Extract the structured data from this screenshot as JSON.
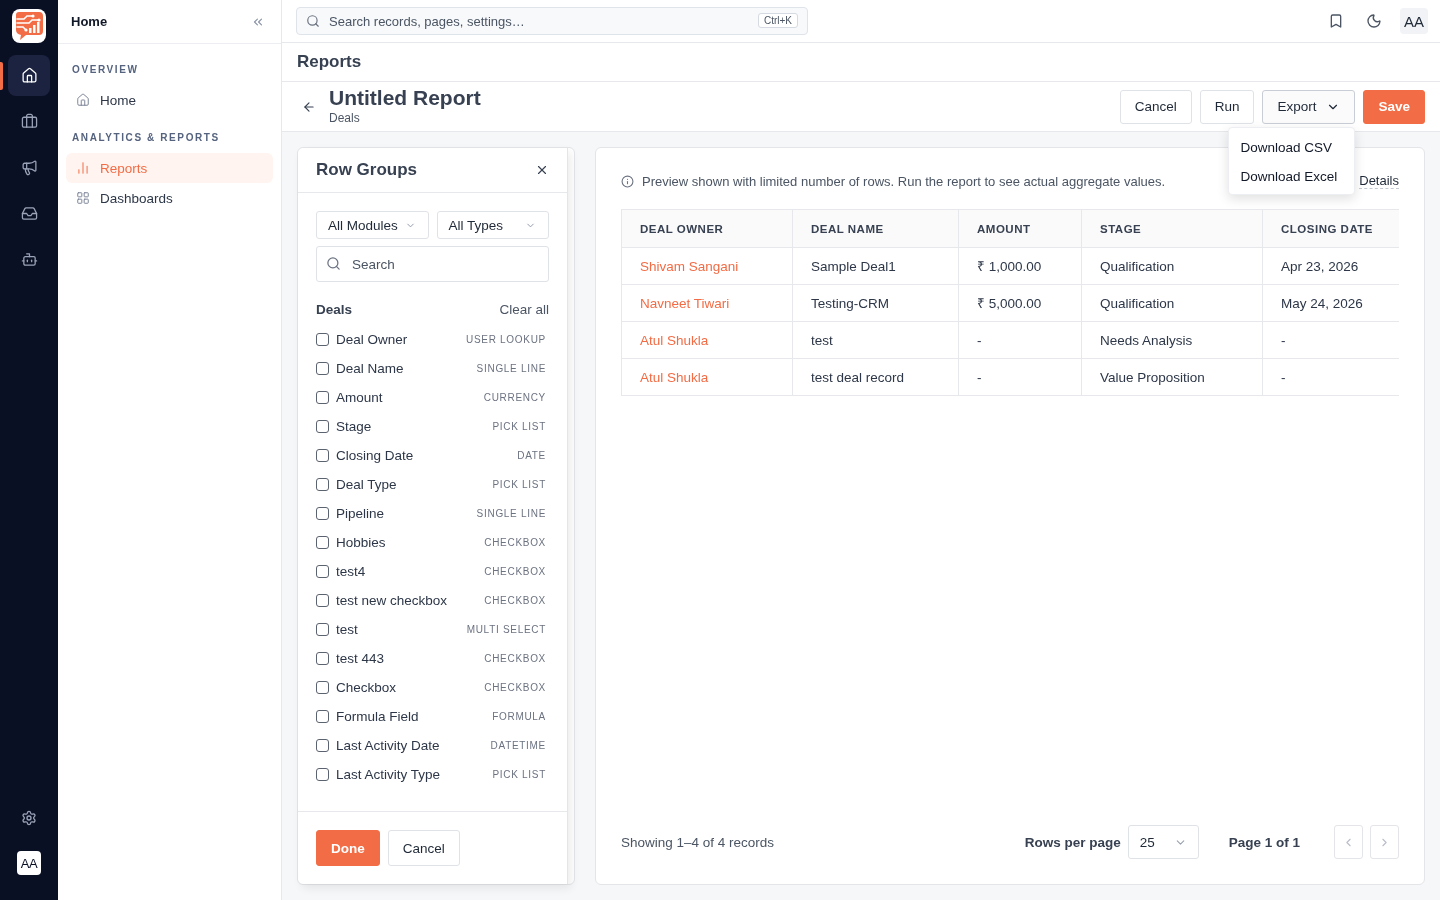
{
  "rail": {
    "nav": [
      {
        "selected": true
      },
      {
        "selected": false
      },
      {
        "selected": false
      },
      {
        "selected": false
      },
      {
        "selected": false
      }
    ],
    "avatar": "AA"
  },
  "sidebar": {
    "title": "Home",
    "sections": [
      {
        "heading": "OVERVIEW",
        "items": [
          {
            "label": "Home",
            "selected": false
          }
        ]
      },
      {
        "heading": "ANALYTICS & REPORTS",
        "items": [
          {
            "label": "Reports",
            "selected": true
          },
          {
            "label": "Dashboards",
            "selected": false
          }
        ]
      }
    ]
  },
  "topbar": {
    "search": {
      "placeholder": "Search records, pages, settings…",
      "shortcut": "Ctrl+K"
    },
    "avatar": "AA"
  },
  "page": {
    "section_title": "Reports",
    "report_title": "Untitled Report",
    "module": "Deals",
    "actions": [
      {
        "label": "Cancel",
        "kind": "secondary"
      },
      {
        "label": "Run",
        "kind": "secondary"
      },
      {
        "label": "Export",
        "kind": "menu",
        "expanded": true,
        "menu": [
          "Download CSV",
          "Download Excel"
        ]
      },
      {
        "label": "Save",
        "kind": "primary"
      }
    ]
  },
  "row_groups": {
    "title": "Row Groups",
    "filters": [
      {
        "value": "All Modules"
      },
      {
        "value": "All Types"
      }
    ],
    "search": {
      "placeholder": "Search"
    },
    "group": {
      "name": "Deals",
      "clear": "Clear all"
    },
    "fields": [
      {
        "label": "Deal Owner",
        "type": "USER LOOKUP",
        "checked": false
      },
      {
        "label": "Deal Name",
        "type": "SINGLE LINE",
        "checked": false
      },
      {
        "label": "Amount",
        "type": "CURRENCY",
        "checked": false
      },
      {
        "label": "Stage",
        "type": "PICK LIST",
        "checked": false
      },
      {
        "label": "Closing Date",
        "type": "DATE",
        "checked": false
      },
      {
        "label": "Deal Type",
        "type": "PICK LIST",
        "checked": false
      },
      {
        "label": "Pipeline",
        "type": "SINGLE LINE",
        "checked": false
      },
      {
        "label": "Hobbies",
        "type": "CHECKBOX",
        "checked": false
      },
      {
        "label": "test4",
        "type": "CHECKBOX",
        "checked": false
      },
      {
        "label": "test new checkbox",
        "type": "CHECKBOX",
        "checked": false
      },
      {
        "label": "test",
        "type": "MULTI SELECT",
        "checked": false
      },
      {
        "label": "test 443",
        "type": "CHECKBOX",
        "checked": false
      },
      {
        "label": "Checkbox",
        "type": "CHECKBOX",
        "checked": false
      },
      {
        "label": "Formula Field",
        "type": "FORMULA",
        "checked": false
      },
      {
        "label": "Last Activity Date",
        "type": "DATETIME",
        "checked": false
      },
      {
        "label": "Last Activity Type",
        "type": "PICK LIST",
        "checked": false
      }
    ],
    "buttons": [
      {
        "label": "Done",
        "kind": "primary"
      },
      {
        "label": "Cancel",
        "kind": "secondary"
      }
    ]
  },
  "preview": {
    "notice": "Preview shown with limited number of rows. Run the report to see actual aggregate values.",
    "link": "Details",
    "table": {
      "columns": [
        {
          "label": "DEAL OWNER",
          "kind": "link"
        },
        {
          "label": "DEAL NAME",
          "kind": "text"
        },
        {
          "label": "AMOUNT",
          "kind": "text"
        },
        {
          "label": "STAGE",
          "kind": "text"
        },
        {
          "label": "CLOSING DATE",
          "kind": "text"
        }
      ],
      "rows": [
        {
          "cells": [
            "Shivam Sangani",
            "Sample Deal1",
            "₹ 1,000.00",
            "Qualification",
            "Apr 23, 2026"
          ]
        },
        {
          "cells": [
            "Navneet Tiwari",
            "Testing-CRM",
            "₹ 5,000.00",
            "Qualification",
            "May 24, 2026"
          ]
        },
        {
          "cells": [
            "Atul Shukla",
            "test",
            "-",
            "Needs Analysis",
            "-"
          ]
        },
        {
          "cells": [
            "Atul Shukla",
            "test deal record",
            "-",
            "Value Proposition",
            "-"
          ]
        }
      ]
    },
    "footer": {
      "summary": "Showing 1–4 of 4 records",
      "rows_per_page_label": "Rows per page",
      "rows_per_page": "25",
      "page": "Page 1 of 1",
      "pager": [
        {
          "disabled": true
        },
        {
          "disabled": true
        }
      ]
    }
  }
}
